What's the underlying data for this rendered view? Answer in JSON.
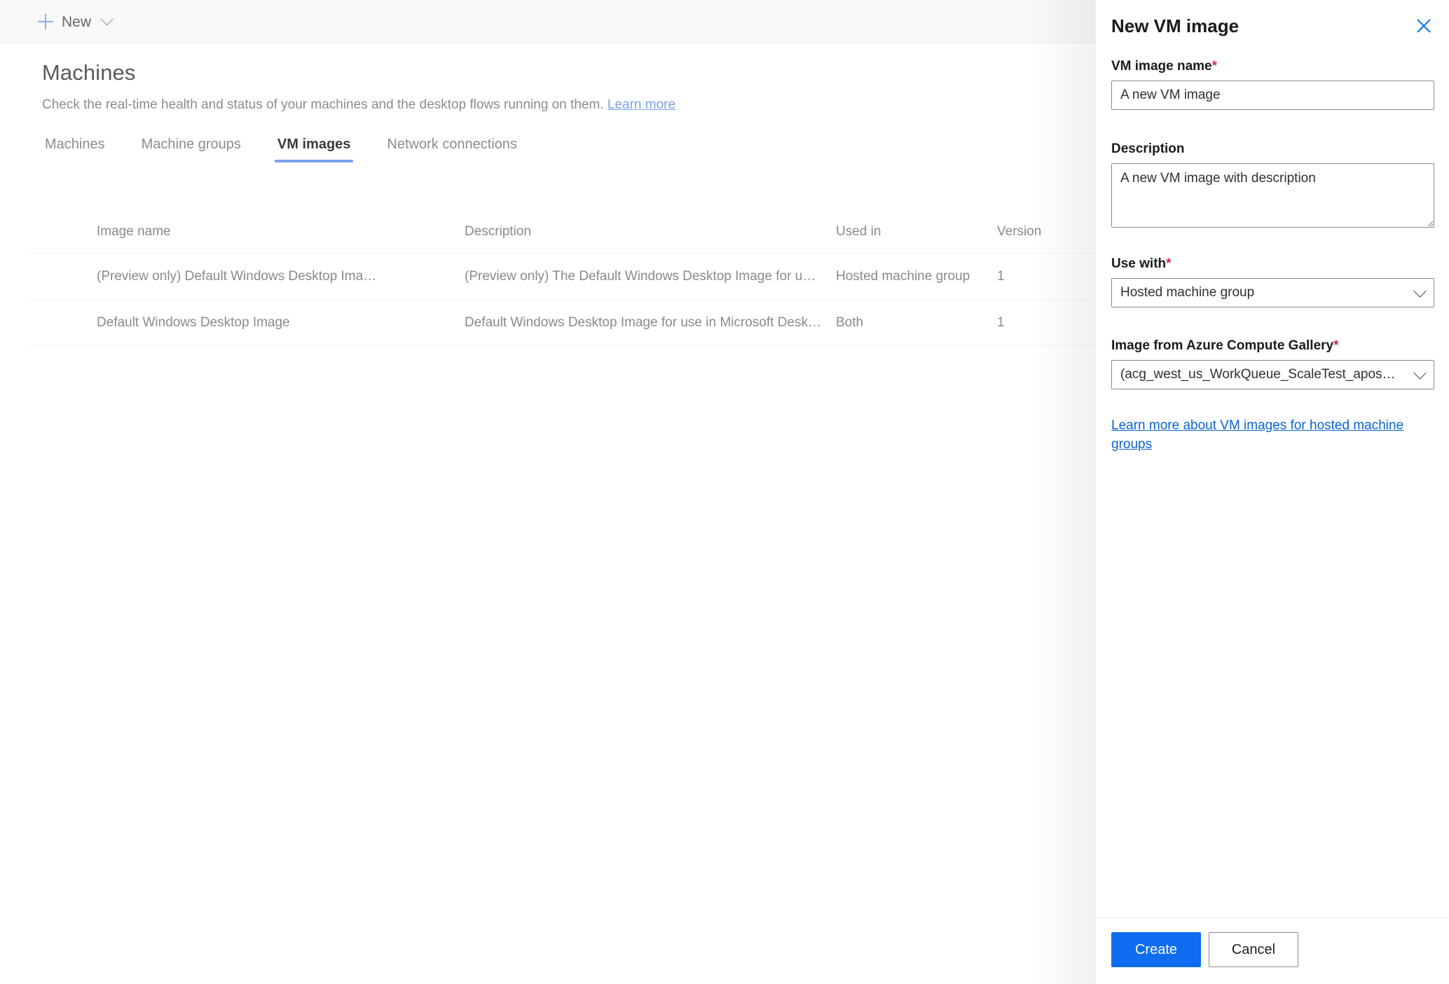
{
  "command_bar": {
    "new_label": "New",
    "plus_icon": "plus-icon",
    "chevron_icon": "chevron-down-icon"
  },
  "page": {
    "title": "Machines",
    "subtitle_text": "Check the real-time health and status of your machines and the desktop flows running on them.",
    "subtitle_link": "Learn more"
  },
  "tabs": [
    {
      "label": "Machines",
      "selected": false
    },
    {
      "label": "Machine groups",
      "selected": false
    },
    {
      "label": "VM images",
      "selected": true
    },
    {
      "label": "Network connections",
      "selected": false
    }
  ],
  "table": {
    "columns": [
      "Image name",
      "Description",
      "Used in",
      "Version"
    ],
    "rows": [
      {
        "image_name": "(Preview only) Default Windows Desktop Ima…",
        "description": "(Preview only) The Default Windows Desktop Image for use i…",
        "used_in": "Hosted machine group",
        "version": "1"
      },
      {
        "image_name": "Default Windows Desktop Image",
        "description": "Default Windows Desktop Image for use in Microsoft Deskto…",
        "used_in": "Both",
        "version": "1"
      }
    ]
  },
  "panel": {
    "title": "New VM image",
    "close_icon": "close-icon",
    "fields": {
      "vm_image_name": {
        "label": "VM image name",
        "required_marker": "*",
        "value": "A new VM image"
      },
      "description": {
        "label": "Description",
        "value": "A new VM image with description"
      },
      "use_with": {
        "label": "Use with",
        "required_marker": "*",
        "value": "Hosted machine group",
        "chevron_icon": "chevron-down-icon"
      },
      "image_from_gallery": {
        "label": "Image from Azure Compute Gallery",
        "required_marker": "*",
        "value": "(acg_west_us_WorkQueue_ScaleTest_apos…",
        "chevron_icon": "chevron-down-icon"
      }
    },
    "learn_more_link": "Learn more about VM images for hosted machine groups",
    "footer": {
      "create_label": "Create",
      "cancel_label": "Cancel"
    }
  },
  "colors": {
    "accent_blue": "#0f6cf0",
    "tab_underline": "#7aa2e8",
    "link_blue": "#0a63d3",
    "required_red": "#c4314b",
    "command_bar_bg": "#f8f8f8"
  }
}
